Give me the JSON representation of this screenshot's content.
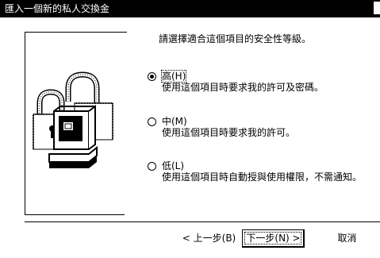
{
  "window": {
    "title": "匯入一個新的私人交換金"
  },
  "content": {
    "instruction": "請選擇適合這個項目的安全性等級。"
  },
  "options": [
    {
      "label": "高(H)",
      "description": "使用這個項目時要求我的許可及密碼。",
      "checked": true
    },
    {
      "label": "中(M)",
      "description": "使用這個項目時要求我的許可。",
      "checked": false
    },
    {
      "label": "低(L)",
      "description": "使用這個項目時自動授與使用權限，不需通知。",
      "checked": false
    }
  ],
  "buttons": {
    "back": "< 上一步(B)",
    "next": "下一步(N) >",
    "cancel": "取消"
  },
  "icons": {
    "illustration": "padlock-computer-icon"
  }
}
